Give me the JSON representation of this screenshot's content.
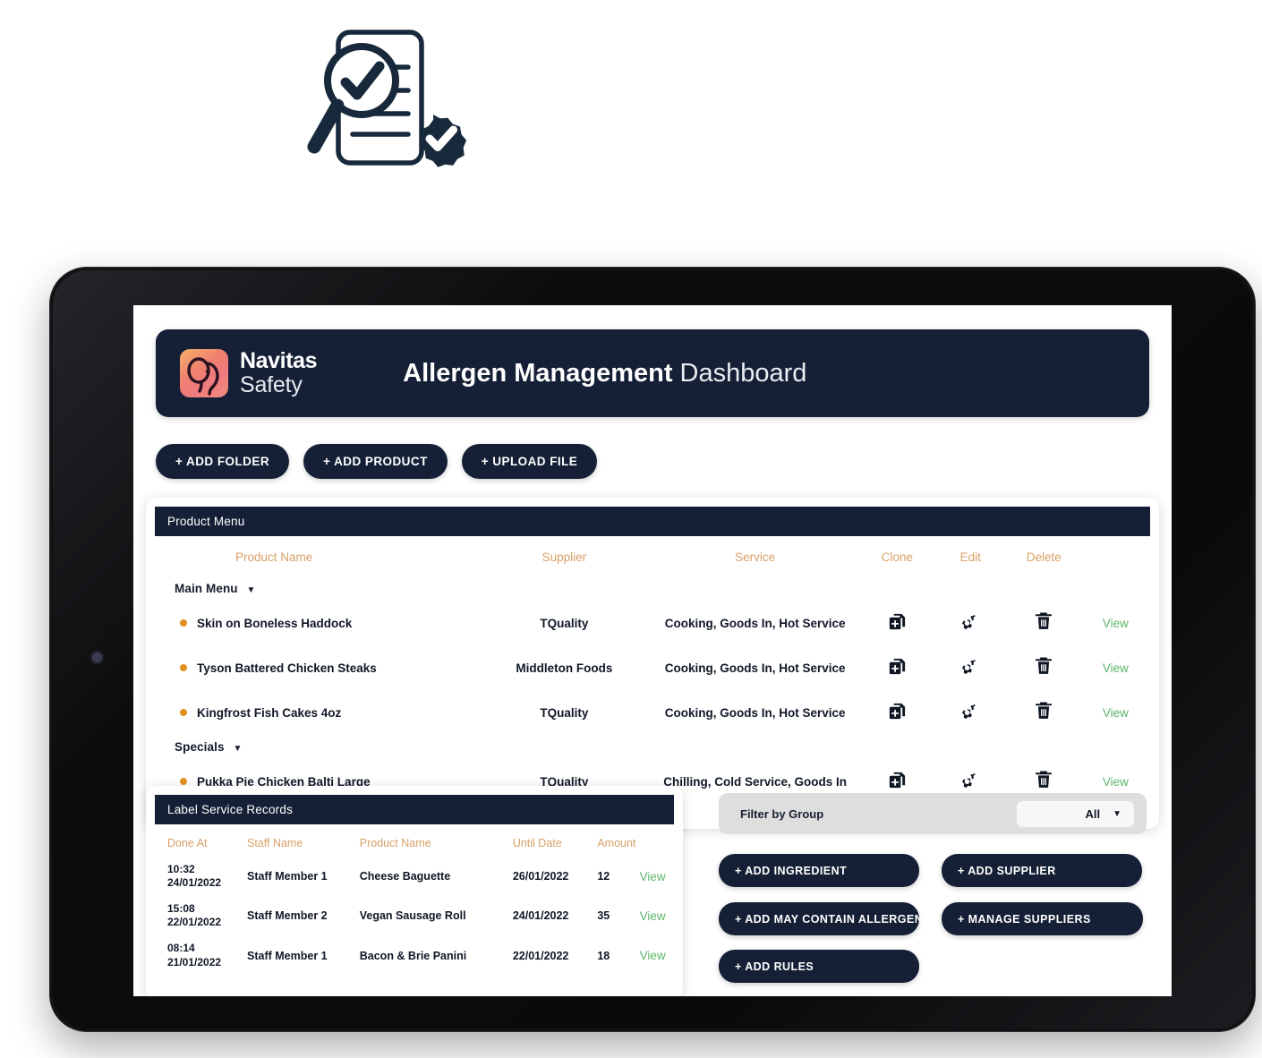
{
  "hero": {
    "icon": "document-check-magnifier-icon"
  },
  "device": {
    "type": "tablet",
    "camera": "front-camera-dot"
  },
  "appbar": {
    "brand_line1": "Navitas",
    "brand_line2": "Safety",
    "logo_icon": "elephant-logo-icon",
    "title_bold": "Allergen Management",
    "title_light": "Dashboard"
  },
  "toolbar": {
    "add_folder": "+ ADD FOLDER",
    "add_product": "+ ADD PRODUCT",
    "upload_file": "+ UPLOAD FILE"
  },
  "product_menu": {
    "panel_title": "Product Menu",
    "columns": [
      "Product Name",
      "Supplier",
      "Service",
      "Clone",
      "Edit",
      "Delete"
    ],
    "groups": [
      {
        "label": "Main Menu",
        "caret": "▼",
        "rows": [
          {
            "name": "Skin on Boneless Haddock",
            "supplier": "TQuality",
            "service": "Cooking, Goods In, Hot Service",
            "view": "View"
          },
          {
            "name": "Tyson Battered Chicken Steaks",
            "supplier": "Middleton Foods",
            "service": "Cooking, Goods In, Hot Service",
            "view": "View"
          },
          {
            "name": "Kingfrost Fish Cakes 4oz",
            "supplier": "TQuality",
            "service": "Cooking, Goods In, Hot Service",
            "view": "View"
          }
        ]
      },
      {
        "label": "Specials",
        "caret": "▼",
        "rows": [
          {
            "name": "Pukka Pie Chicken Balti Large",
            "supplier": "TQuality",
            "service": "Chilling, Cold Service, Goods In",
            "view": "View"
          }
        ]
      }
    ]
  },
  "label_service_records": {
    "panel_title": "Label Service Records",
    "columns": [
      "Done At",
      "Staff Name",
      "Product Name",
      "Until Date",
      "Amount"
    ],
    "rows": [
      {
        "time": "10:32",
        "date": "24/01/2022",
        "staff": "Staff Member 1",
        "product": "Cheese Baguette",
        "until": "26/01/2022",
        "amount": "12",
        "view": "View"
      },
      {
        "time": "15:08",
        "date": "22/01/2022",
        "staff": "Staff Member 2",
        "product": "Vegan Sausage Roll",
        "until": "24/01/2022",
        "amount": "35",
        "view": "View"
      },
      {
        "time": "08:14",
        "date": "21/01/2022",
        "staff": "Staff Member 1",
        "product": "Bacon & Brie Panini",
        "until": "22/01/2022",
        "amount": "18",
        "view": "View"
      }
    ]
  },
  "filter": {
    "label": "Filter by Group",
    "selected": "All",
    "caret": "▼"
  },
  "actions": {
    "add_ingredient": "+ ADD INGREDIENT",
    "add_supplier": "+ ADD SUPPLIER",
    "add_may_contain": "+ ADD MAY CONTAIN ALLERGENS",
    "manage_suppliers": "+ MANAGE SUPPLIERS",
    "add_rules": "+ ADD RULES"
  },
  "colors": {
    "navy": "#152036",
    "accent_gold": "#d7a167",
    "bullet_orange": "#e2901f",
    "link_green": "#5eb469",
    "filter_bar": "#dedede"
  }
}
